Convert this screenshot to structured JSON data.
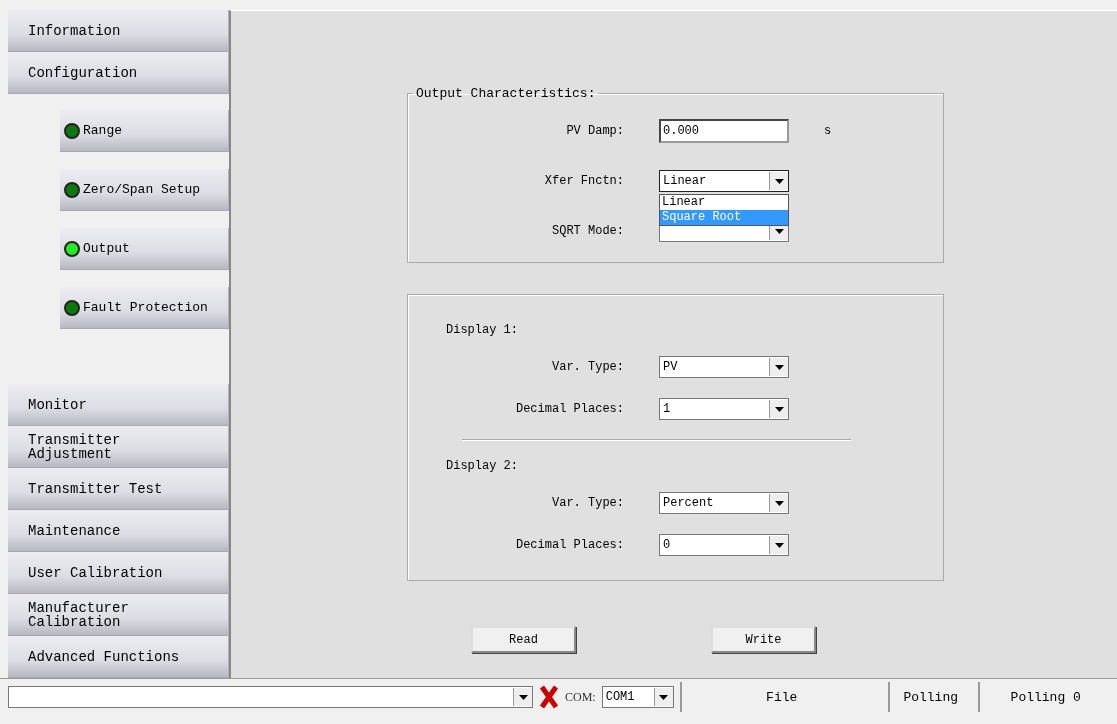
{
  "sidebar": {
    "items": [
      {
        "label": "Information"
      },
      {
        "label": "Configuration",
        "children": [
          {
            "label": "Range",
            "selected": false
          },
          {
            "label": "Zero/Span Setup",
            "selected": false
          },
          {
            "label": "Output",
            "selected": true
          },
          {
            "label": "Fault Protection",
            "selected": false
          }
        ]
      },
      {
        "label": "Monitor"
      },
      {
        "label": "Transmitter Adjustment"
      },
      {
        "label": "Transmitter Test"
      },
      {
        "label": "Maintenance"
      },
      {
        "label": "User Calibration"
      },
      {
        "label": "Manufacturer Calibration"
      },
      {
        "label": "Advanced Functions"
      }
    ]
  },
  "output_group": {
    "title": "Output Characteristics:",
    "fields": [
      {
        "kind": "number",
        "label": "PV Damp:",
        "value": "0.000",
        "unit": "s"
      },
      {
        "kind": "select",
        "label": "Xfer Fnctn:",
        "value": "Linear",
        "expanded": true,
        "options": [
          {
            "label": "Linear",
            "highlighted": false
          },
          {
            "label": "Square Root",
            "highlighted": true
          }
        ]
      },
      {
        "kind": "select",
        "label": "SQRT Mode:"
      }
    ]
  },
  "display_group": {
    "sections": [
      {
        "title": "Display 1:",
        "fields": [
          {
            "kind": "select",
            "label": "Var. Type:",
            "value": "PV"
          },
          {
            "kind": "select",
            "label": "Decimal Places:",
            "value": "1"
          }
        ]
      },
      {
        "title": "Display 2:",
        "fields": [
          {
            "kind": "select",
            "label": "Var. Type:",
            "value": "Percent"
          },
          {
            "kind": "select",
            "label": "Decimal Places:",
            "value": "0"
          }
        ]
      }
    ]
  },
  "buttons": [
    "Read",
    "Write"
  ],
  "status_bar": {
    "port_label": "COM:",
    "port": "COM1",
    "connected": false,
    "panels": [
      "File",
      "Polling",
      "Polling 0"
    ]
  }
}
